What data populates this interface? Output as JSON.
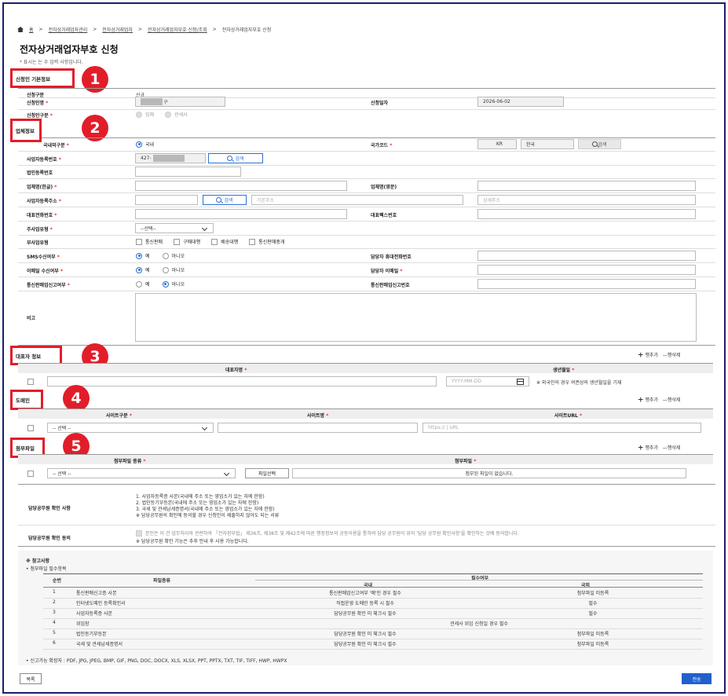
{
  "breadcrumb": {
    "home": "홈",
    "items": [
      "전자상거래업자관리",
      "전자상거래업자",
      "전자상거래업자부호 신청/조회",
      "전자상거래업자부호 신청"
    ],
    "sep": ">"
  },
  "page_title": "전자상거래업자부호 신청",
  "required_note": {
    "mark": "*",
    "text": "표시는 는 수 입력 사항입니다."
  },
  "badges": [
    "1",
    "2",
    "3",
    "4",
    "5"
  ],
  "sections": {
    "basic": "신청인 기본정보",
    "company": "업체정보",
    "rep": "대표자 정보",
    "domain": "도메인",
    "attach": "첨부파일"
  },
  "basic": {
    "type_label": "신청구분",
    "type_value": "신규",
    "name_label": "신청인명",
    "name_value": "구",
    "date_label": "신청일자",
    "date_value": "2026-06-02",
    "kind_label": "신청인구분",
    "kind_opts": [
      "업체",
      "관세사"
    ]
  },
  "company": {
    "domestic_label": "국내외구분",
    "domestic_opt": "국내",
    "country_label": "국가코드",
    "country_code": "KR",
    "country_name": "한국",
    "search": "검색",
    "bizno_label": "사업자등록번호",
    "bizno_value": "427-",
    "corpno_label": "법인등록번호",
    "name_kr_label": "업체명(한글)",
    "name_en_label": "업체명(영문)",
    "addr_label": "사업자등록주소",
    "addr_base_ph": "기본주소",
    "addr_detail_ph": "상세주소",
    "tel_label": "대표전화번호",
    "fax_label": "대표팩스번호",
    "main_biz_label": "주사업유형",
    "main_biz_value": "--선택--",
    "sub_biz_label": "부사업유형",
    "sub_biz_opts": [
      "통신판매",
      "구매대행",
      "배송대행",
      "통신판매중개"
    ],
    "sms_label": "SMS수신여부",
    "email_recv_label": "이메일 수신여부",
    "report_label": "통신판매업신고여부",
    "yes": "예",
    "no": "아니오",
    "mobile_label": "담당자 휴대전화번호",
    "email_label": "담당자 이메일",
    "report_no_label": "통신판매업신고번호",
    "memo_label": "비고"
  },
  "rows": {
    "add": "행추가",
    "del": "행삭제"
  },
  "rep": {
    "col_name": "대표자명",
    "col_birth": "생년월일",
    "birth_ph": "YYYY-MM-DD",
    "note": "※ 외국인의 경우 여권상의 생년월일을 기재"
  },
  "domain": {
    "col_type": "사이트구분",
    "col_name": "사이트명",
    "col_url": "사이트URL",
    "select": "-- 선택 --",
    "url_ph": "https:// | URL"
  },
  "attach": {
    "col_type": "첨부파일 종류",
    "col_file": "첨부파일",
    "select": "-- 선택 --",
    "btn": "파일선택",
    "empty": "첨부된 파일이 없습니다."
  },
  "officer": {
    "check_label": "담당공무원 확인 사항",
    "check_lines": [
      "1. 사업자등록증 사본(국내에 주소 또는 영업소가 있는 자에 한함)",
      "2. 법인등기부등본(국내에 주소 또는 영업소가 있는 자에 한함)",
      "3. 국세 및 관세납세증명서(국내에 주소 또는 영업소가 있는 자에 한함)",
      "※ 담당공무원의 확인에 동의할 경우 신청인이 제출하지 않아도 되는 서류"
    ],
    "agree_label": "담당공무원 확인 동의",
    "agree_text": "본인은 이 건 업무처리와 관련하여 「전자정부법」 제36조, 제38조 및 제42조에 따른 행정정보의 공동이용을 통하여 담당 공무원이 위의 '담당 공무원 확인사항'을 확인하는 것에 동의합니다.",
    "agree_note": "※ 담당공무원 확인 기능은 추후 안내 후 사용 가능합니다."
  },
  "reference": {
    "title": "※ 참고사항",
    "sub": "• 첨부파일 필수항목",
    "headers": [
      "순번",
      "파일종류",
      "필수여부",
      "국내",
      "국외"
    ],
    "rows": [
      [
        "1",
        "통신판매신고증 사본",
        "통신판매업신고여부 '예'인 경우 필수",
        "첨부파일 미등록"
      ],
      [
        "2",
        "인터넷도메인 등록확인서",
        "직접운영 도메인 등록 시 필수",
        "필수"
      ],
      [
        "3",
        "사업자등록증 사본",
        "담당공무원 확인 미 체크시 필수",
        "필수"
      ],
      [
        "4",
        "위임장",
        "관세사 위임 신청일 경우 필수",
        ""
      ],
      [
        "5",
        "법인등기부등본",
        "담당공무원 확인 미 체크시 필수",
        "첨부파일 미등록"
      ],
      [
        "6",
        "국세 및 관세납세증명서",
        "담당공무원 확인 미 체크시 필수",
        "첨부파일 미등록"
      ]
    ],
    "ext": "• 신고가능 확장자 : PDF, JPG, JPEG, BMP, GIF, PNG, DOC, DOCX, XLS, XLSX, PPT, PPTX, TXT, TIF, TIFF, HWP, HWPX"
  },
  "buttons": {
    "list": "목록",
    "submit": "전송"
  }
}
